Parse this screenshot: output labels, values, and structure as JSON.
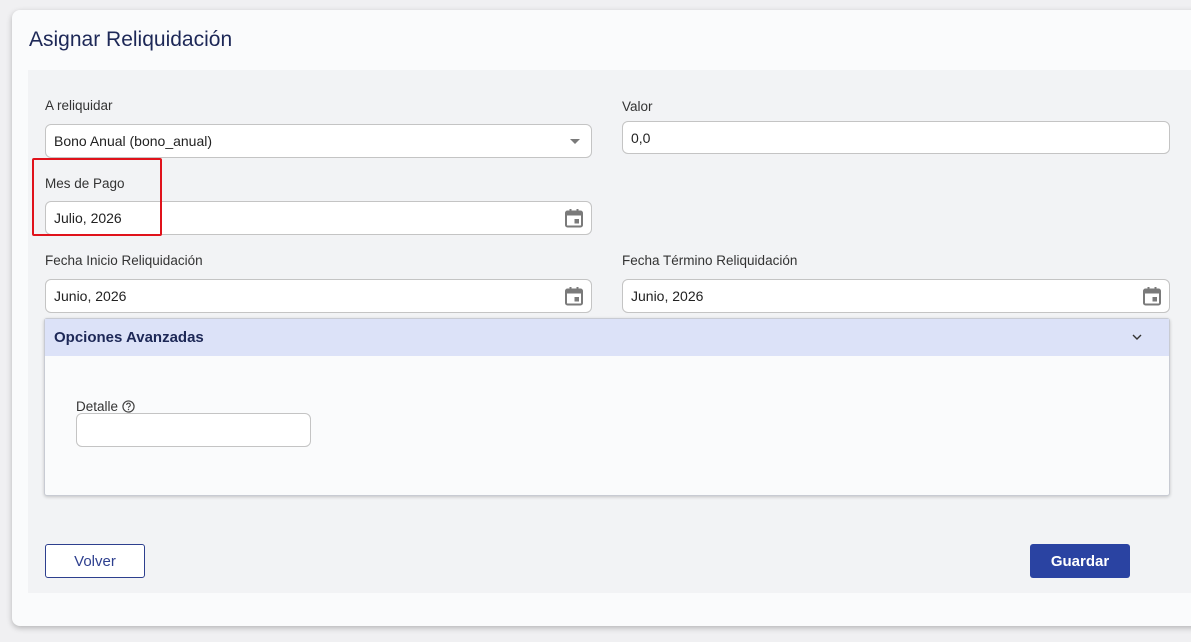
{
  "page": {
    "title": "Asignar Reliquidación"
  },
  "form": {
    "a_reliquidar": {
      "label": "A reliquidar",
      "value": "Bono Anual (bono_anual)"
    },
    "valor": {
      "label": "Valor",
      "value": "0,0"
    },
    "mes_pago": {
      "label": "Mes de Pago",
      "value": "Julio, 2026"
    },
    "fecha_inicio": {
      "label": "Fecha Inicio Reliquidación",
      "value": "Junio, 2026"
    },
    "fecha_termino": {
      "label": "Fecha Término Reliquidación",
      "value": "Junio, 2026"
    }
  },
  "advanced": {
    "title": "Opciones Avanzadas",
    "detalle": {
      "label": "Detalle",
      "value": ""
    }
  },
  "buttons": {
    "back": "Volver",
    "save": "Guardar"
  },
  "colors": {
    "accent": "#2a43a2",
    "title": "#1d2857",
    "highlight": "#e0121b",
    "panel_header": "#dce2f8"
  }
}
